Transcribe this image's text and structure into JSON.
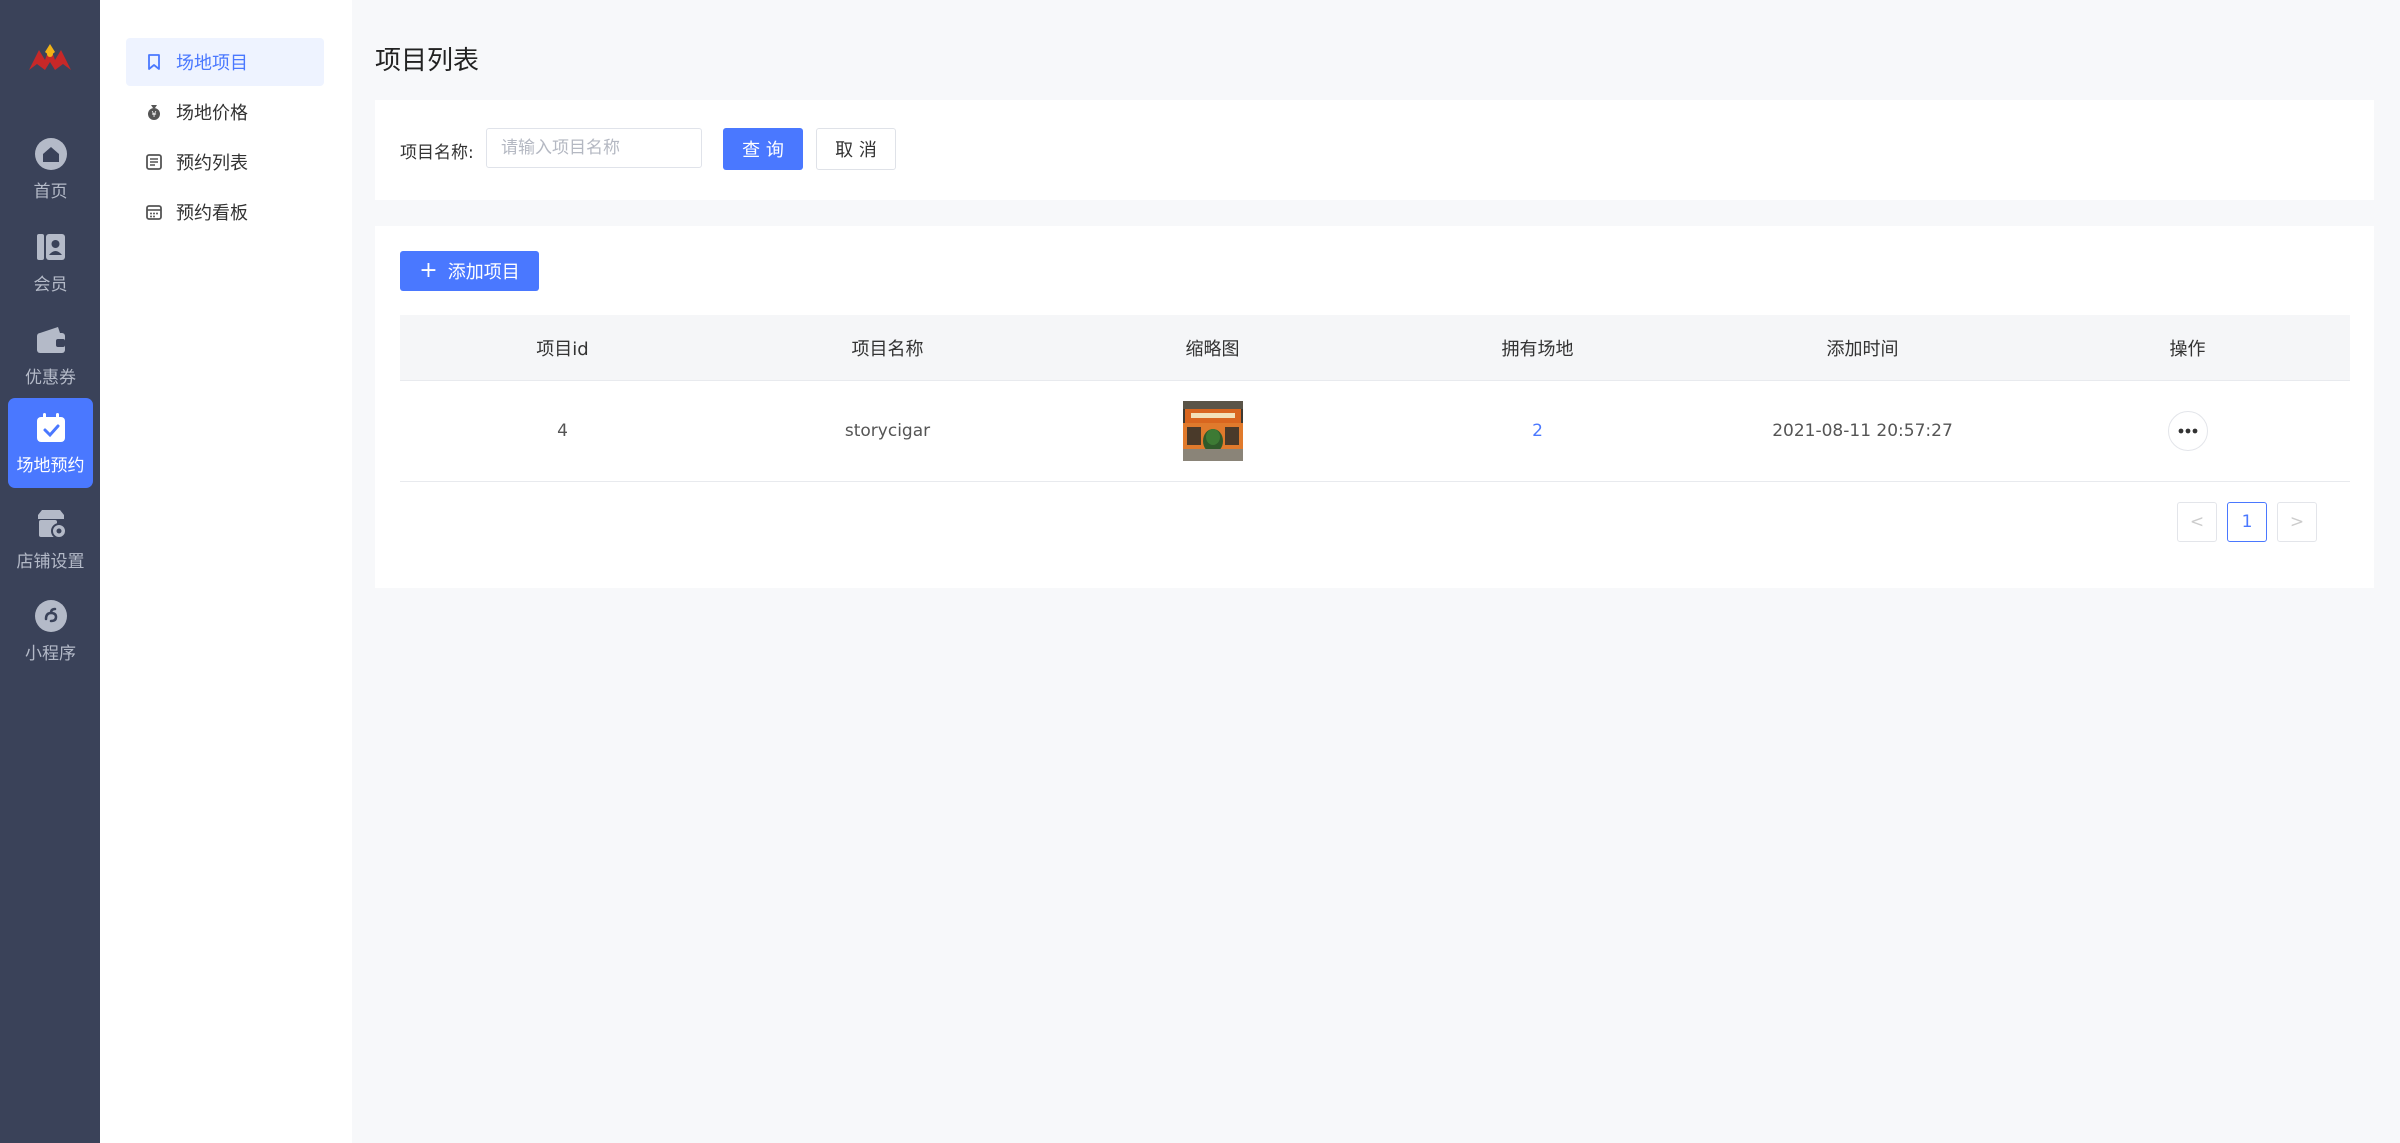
{
  "nav": {
    "items": [
      {
        "label": "首页",
        "icon": "home-icon"
      },
      {
        "label": "会员",
        "icon": "member-card-icon"
      },
      {
        "label": "优惠券",
        "icon": "wallet-icon"
      },
      {
        "label": "场地预约",
        "icon": "calendar-check-icon",
        "active": true
      },
      {
        "label": "店铺设置",
        "icon": "store-settings-icon"
      },
      {
        "label": "小程序",
        "icon": "mini-program-icon"
      }
    ]
  },
  "submenu": {
    "items": [
      {
        "label": "场地项目",
        "icon": "bookmark-icon",
        "active": true
      },
      {
        "label": "场地价格",
        "icon": "money-bag-icon"
      },
      {
        "label": "预约列表",
        "icon": "list-document-icon"
      },
      {
        "label": "预约看板",
        "icon": "calendar-board-icon"
      }
    ]
  },
  "page": {
    "title": "项目列表"
  },
  "filter": {
    "label": "项目名称:",
    "placeholder": "请输入项目名称",
    "value": "",
    "search_label": "查 询",
    "cancel_label": "取 消"
  },
  "table": {
    "add_label": "添加项目",
    "columns": [
      "项目id",
      "项目名称",
      "缩略图",
      "拥有场地",
      "添加时间",
      "操作"
    ],
    "rows": [
      {
        "id": "4",
        "name": "storycigar",
        "venues": "2",
        "created": "2021-08-11 20:57:27"
      }
    ]
  },
  "pagination": {
    "current": "1",
    "prev": "<",
    "next": ">"
  },
  "colors": {
    "primary": "#4a78ff",
    "nav_bg": "#3a4259",
    "page_bg": "#f7f8fa"
  }
}
